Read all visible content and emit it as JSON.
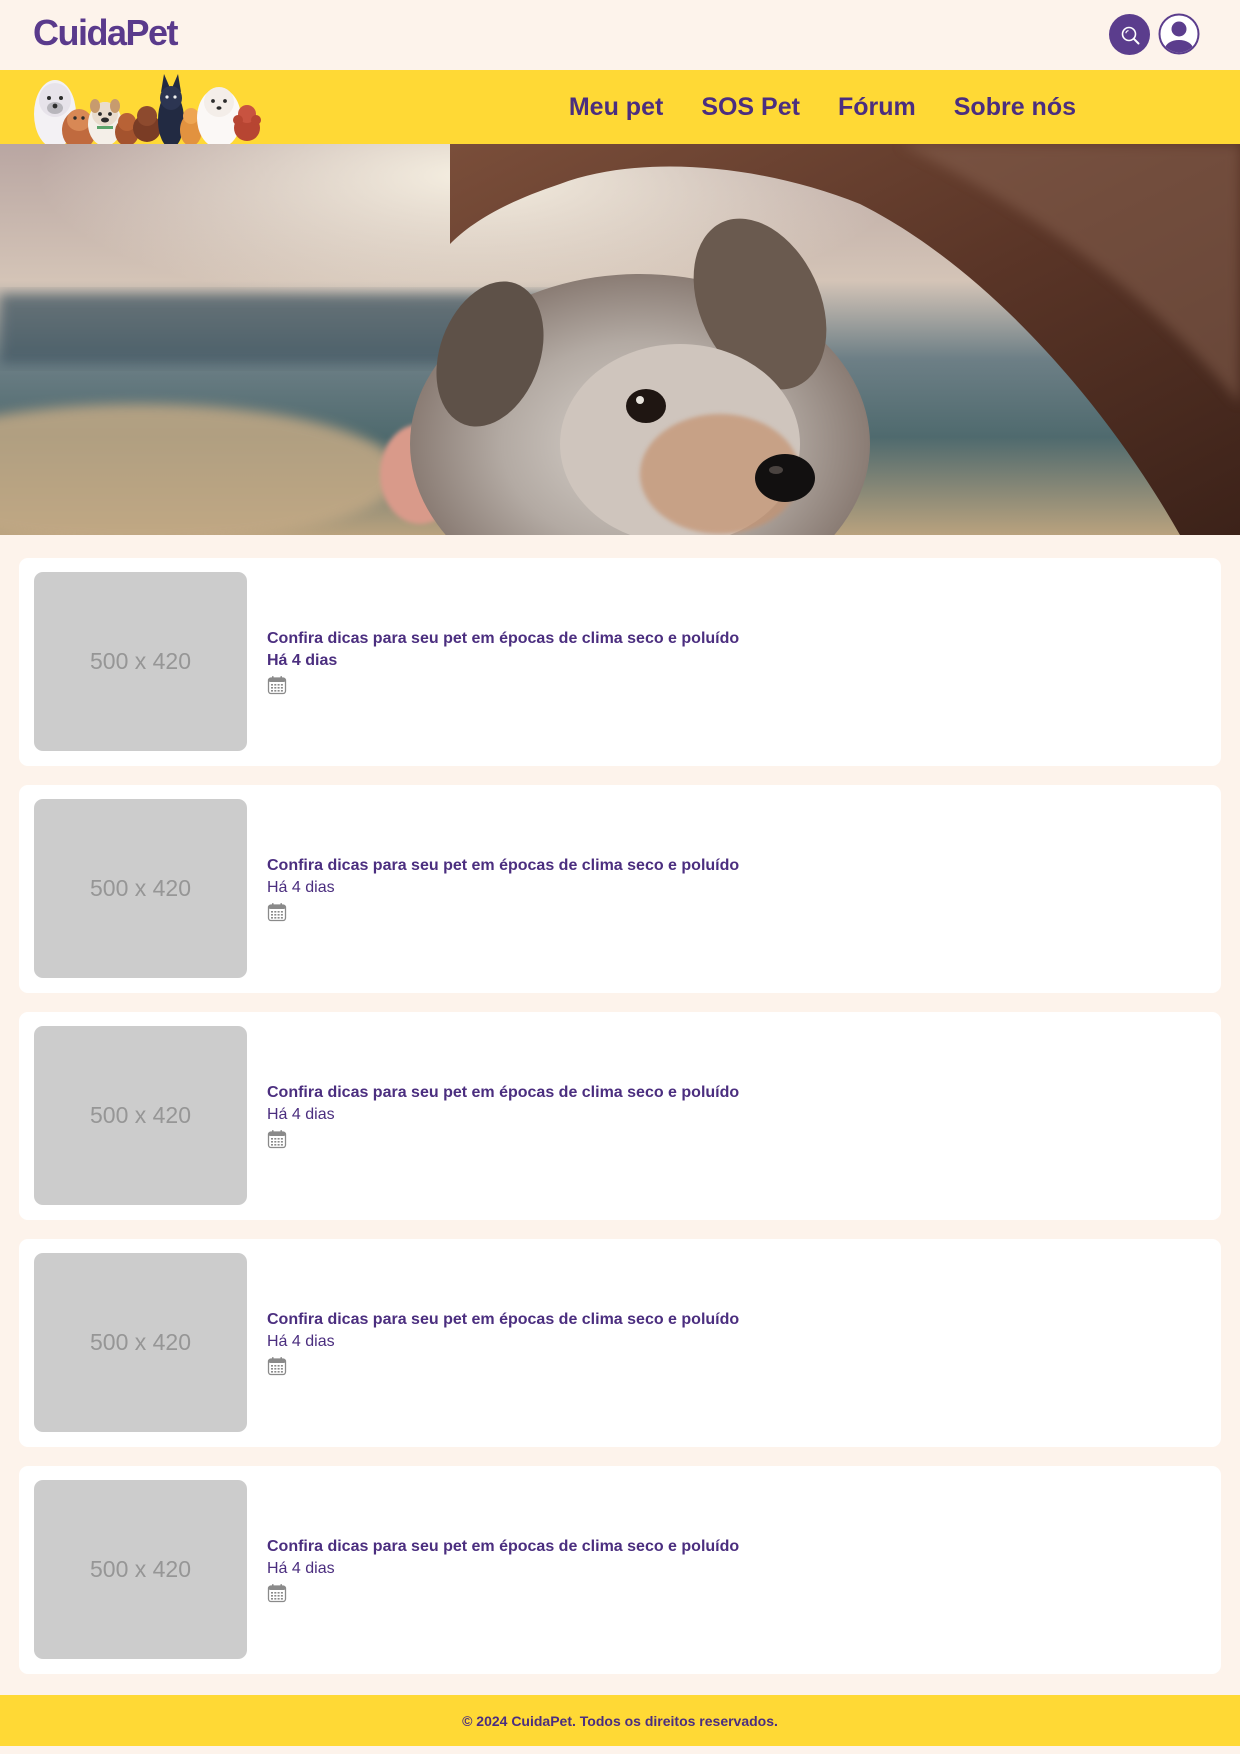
{
  "brand": {
    "logo_text": "CuidaPet",
    "primary_color": "#5a3a8c",
    "accent_color": "#ffd935",
    "background_color": "#fdf3eb"
  },
  "header": {
    "search_icon": "search-icon",
    "user_icon": "user-avatar-icon"
  },
  "nav": {
    "items": [
      {
        "label": "Meu pet"
      },
      {
        "label": "SOS Pet"
      },
      {
        "label": "Fórum"
      },
      {
        "label": "Sobre nós"
      }
    ]
  },
  "articles": [
    {
      "placeholder": "500 x 420",
      "title": "Confira dicas para seu pet em épocas de clima seco e poluído",
      "time": "Há 4 dias",
      "icon": "calendar-icon"
    },
    {
      "placeholder": "500 x 420",
      "title": "Confira dicas para seu pet em épocas de clima seco e poluído",
      "time": "Há 4 dias",
      "icon": "calendar-icon"
    },
    {
      "placeholder": "500 x 420",
      "title": "Confira dicas para seu pet em épocas de clima seco e poluído",
      "time": "Há 4 dias",
      "icon": "calendar-icon"
    },
    {
      "placeholder": "500 x 420",
      "title": "Confira dicas para seu pet em épocas de clima seco e poluído",
      "time": "Há 4 dias",
      "icon": "calendar-icon"
    },
    {
      "placeholder": "500 x 420",
      "title": "Confira dicas para seu pet em épocas de clima seco e poluído",
      "time": "Há 4 dias",
      "icon": "calendar-icon"
    }
  ],
  "footer": {
    "text": "© 2024 CuidaPet. Todos os direitos reservados."
  }
}
